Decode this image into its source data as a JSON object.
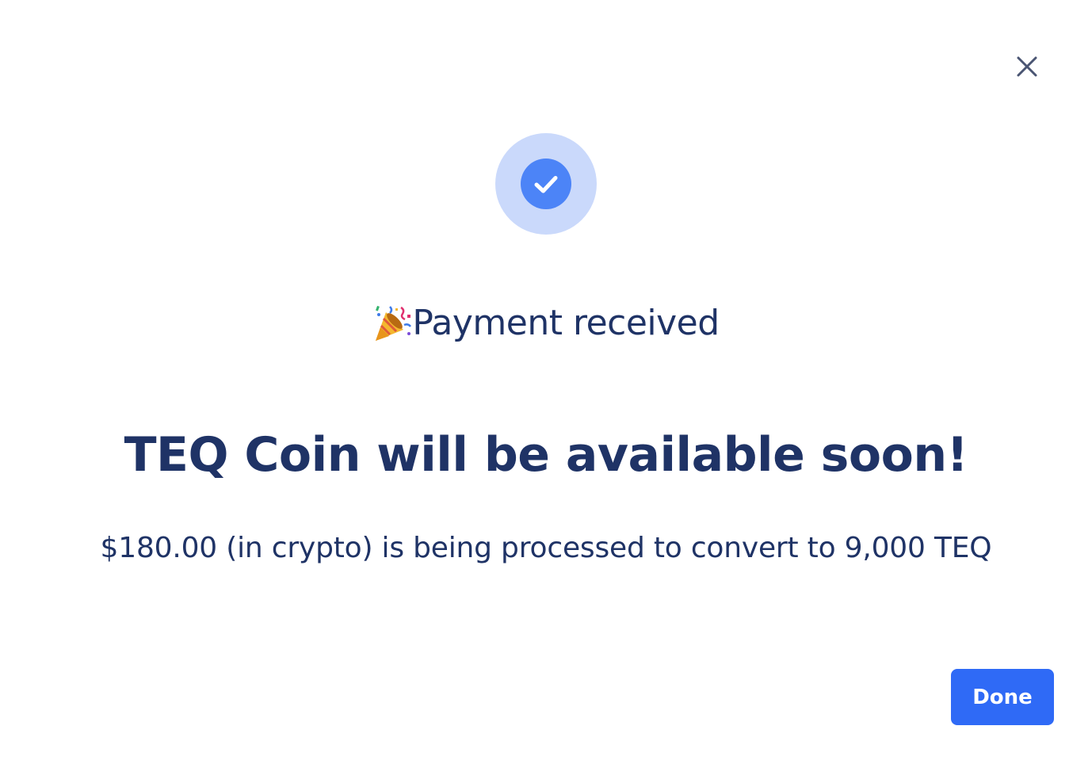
{
  "dialog": {
    "subtitle": "Payment received",
    "headline": "TEQ Coin will be available soon!",
    "description": "$180.00 (in crypto) is being processed to convert to 9,000 TEQ",
    "done_label": "Done"
  },
  "icons": {
    "close": "close-icon",
    "status": "check-circle-icon",
    "party": "party-popper-icon"
  },
  "colors": {
    "text_primary": "#1f3366",
    "close_icon": "#4a5573",
    "ring_outer": "#cad9fb",
    "ring_inner": "#4c84f7",
    "button": "#2f6af6"
  }
}
